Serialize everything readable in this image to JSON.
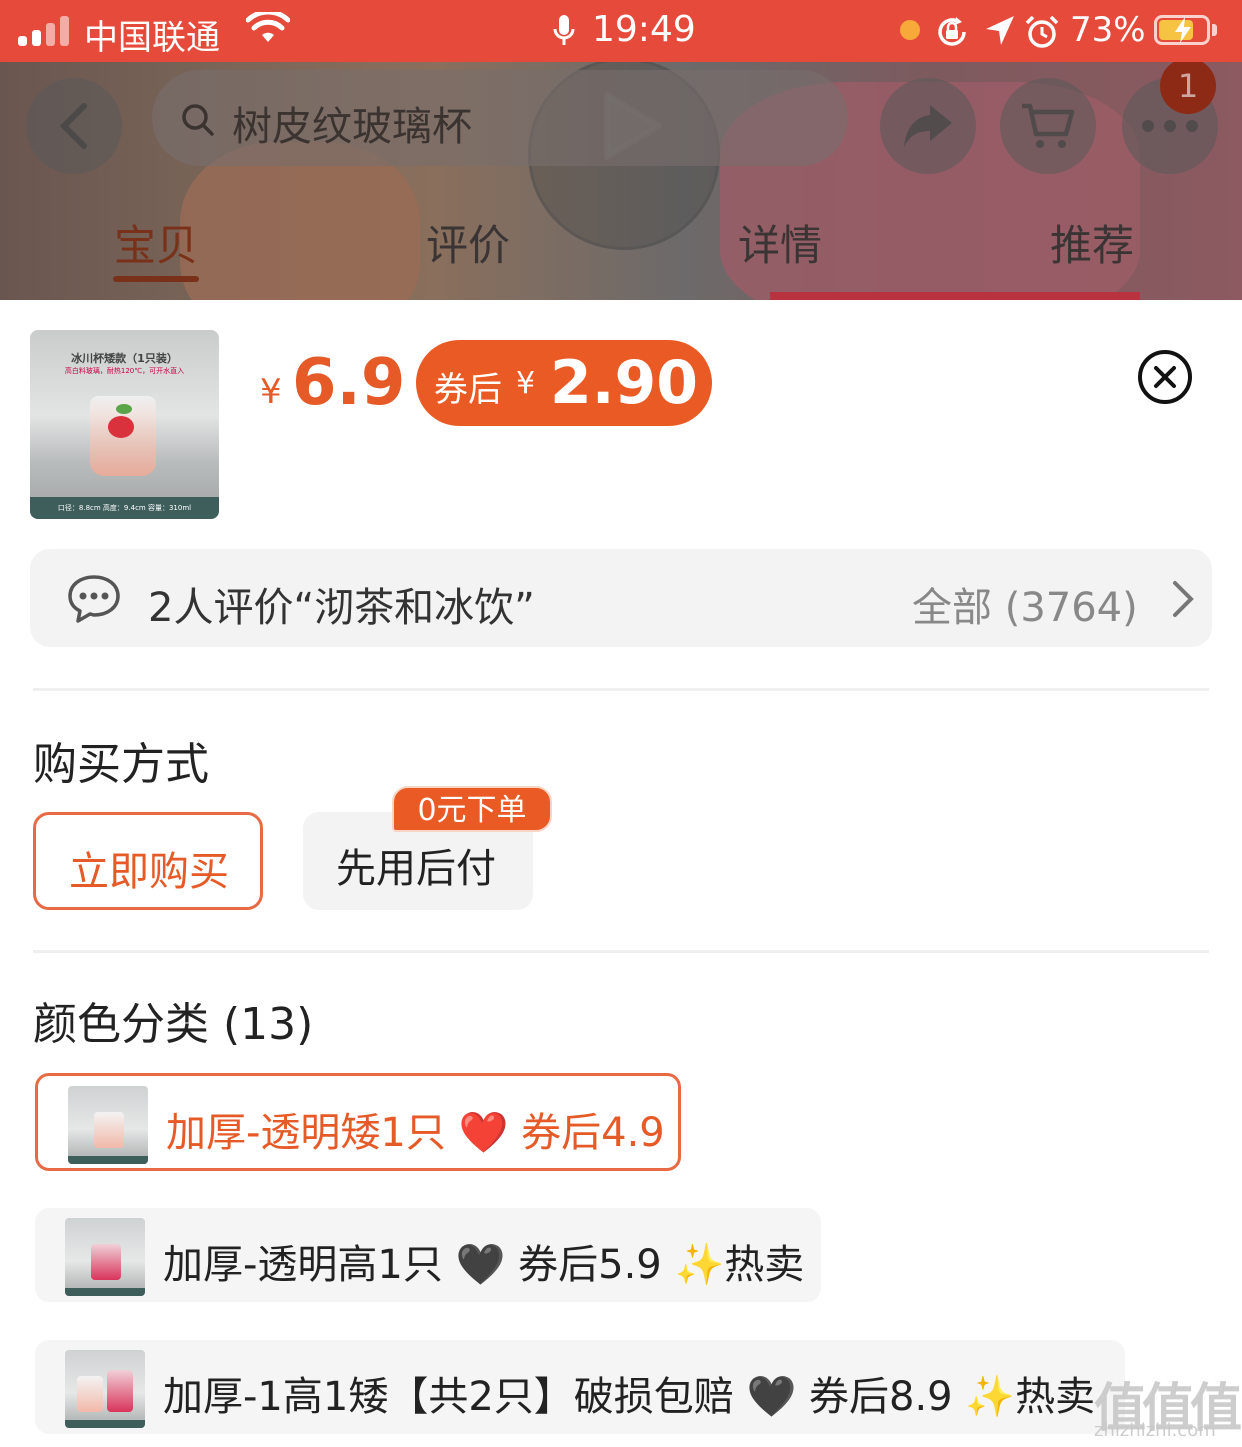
{
  "status_bar": {
    "carrier": "中国联通",
    "time": "19:49",
    "battery_pct": "73%",
    "battery_level": 0.73,
    "icons": [
      "signal-icon",
      "wifi-icon",
      "mic-icon",
      "orientation-lock-icon",
      "location-icon",
      "alarm-icon",
      "battery-charging-icon"
    ]
  },
  "header": {
    "search_text": "树皮纹玻璃杯",
    "cart_badge": "1",
    "tabs": [
      "宝贝",
      "评价",
      "详情",
      "推荐"
    ],
    "active_tab": 0
  },
  "product": {
    "thumb_title": "冰川杯矮款（1只装）",
    "thumb_sub": "高白料玻璃，耐热120℃，可开水直入",
    "thumb_foot": "口径：8.8cm  高度：9.4cm  容量：310ml",
    "price_symbol": "¥",
    "price": "6.9",
    "coupon_label": "券后",
    "coupon_symbol": "¥",
    "coupon_price": "2.90"
  },
  "review": {
    "text": "2人评价“沏茶和冰饮”",
    "all_label": "全部 (3764)"
  },
  "purchase": {
    "title": "购买方式",
    "options": [
      "立即购买",
      "先用后付"
    ],
    "selected": 0,
    "tag": "0元下单"
  },
  "variants": {
    "title": "颜色分类 (13)",
    "items": [
      "加厚-透明矮1只 ❤️ 券后4.9",
      "加厚-透明高1只 🖤 券后5.9 ✨热卖",
      "加厚-1高1矮【共2只】破损包赔 🖤 券后8.9 ✨热卖"
    ],
    "selected": 0
  },
  "watermark": {
    "main": "值值值",
    "sub": "zhizhizhi.com"
  },
  "colors": {
    "status_bar": "#e64a3b",
    "accent": "#e55a26"
  }
}
